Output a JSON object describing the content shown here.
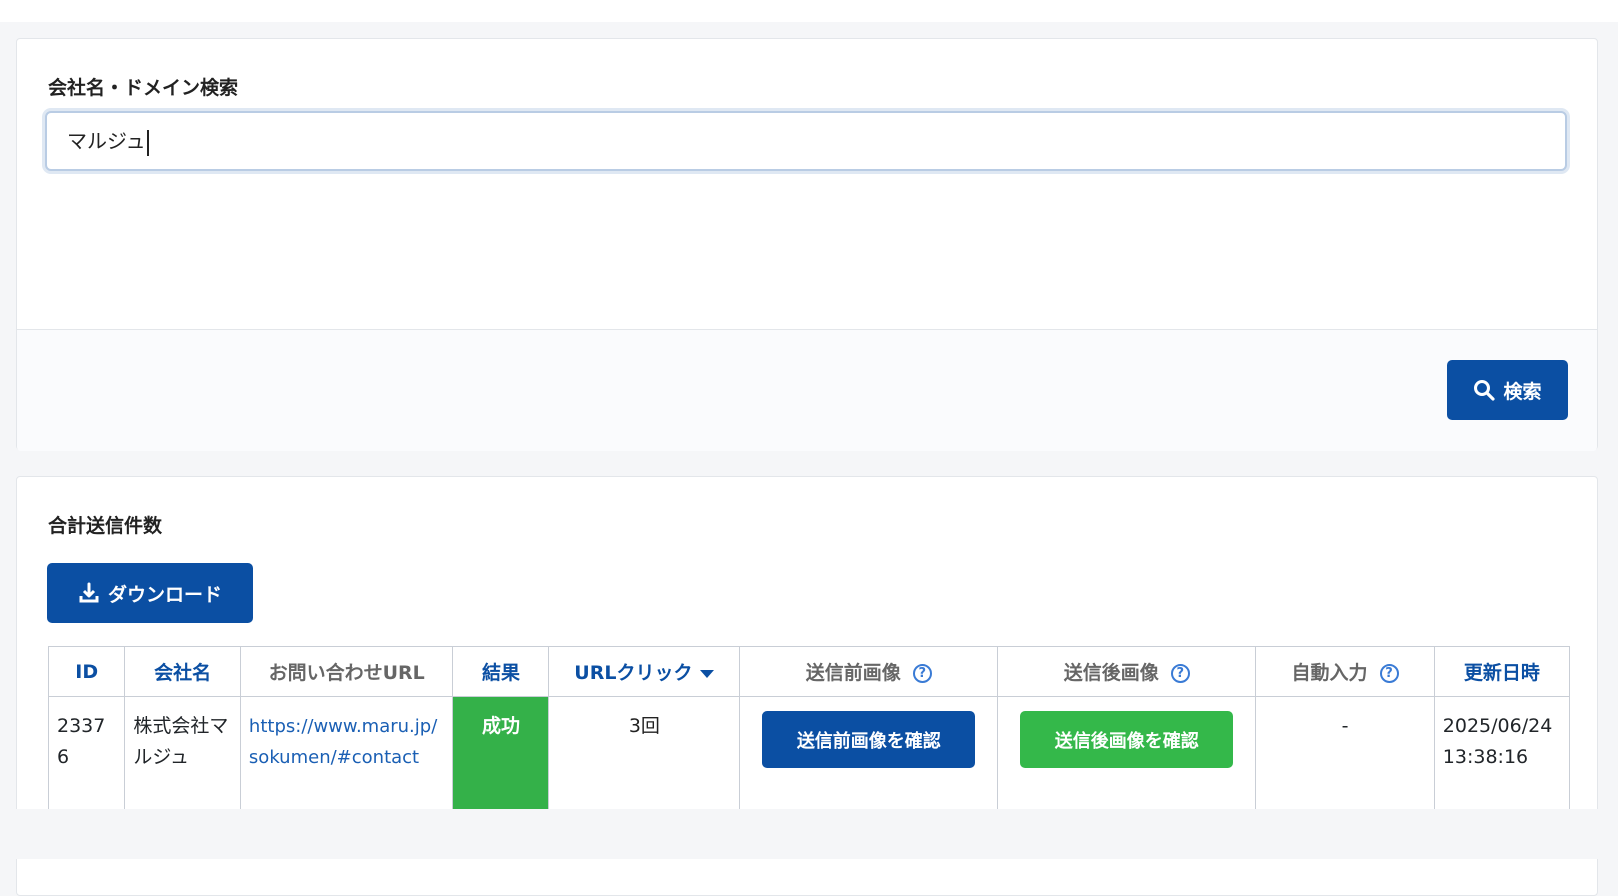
{
  "search": {
    "label": "会社名・ドメイン検索",
    "value": "マルジュ",
    "button_label": "検索"
  },
  "results": {
    "title": "合計送信件数",
    "download_label": "ダウンロード",
    "columns": {
      "id": "ID",
      "company": "会社名",
      "url": "お問い合わせURL",
      "result": "結果",
      "url_click": "URLクリック",
      "before_image": "送信前画像",
      "after_image": "送信後画像",
      "auto_input": "自動入力",
      "updated": "更新日時"
    },
    "rows": [
      {
        "id": "23376",
        "company": "株式会社マルジュ",
        "url": "https://www.maru.jp/sokumen/#contact",
        "result": "成功",
        "url_click": "3回",
        "before_image_button": "送信前画像を確認",
        "after_image_button": "送信後画像を確認",
        "auto_input": "-",
        "updated": "2025/06/24 13:38:16"
      }
    ]
  },
  "colors": {
    "primary": "#0b4fa3",
    "success": "#34b149",
    "link": "#1a5fb4"
  }
}
